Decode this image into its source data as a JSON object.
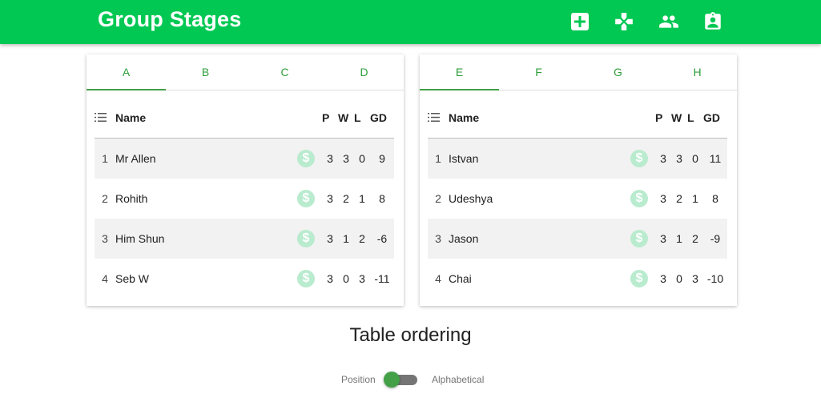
{
  "app": {
    "title": "Group Stages",
    "icons": [
      "add-box-icon",
      "gamepad-icon",
      "people-icon",
      "assignment-ind-icon"
    ],
    "accent": "#00c853"
  },
  "groups_left": {
    "tabs": [
      "A",
      "B",
      "C",
      "D"
    ],
    "active_tab": "A",
    "headers": {
      "name": "Name",
      "p": "P",
      "w": "W",
      "l": "L",
      "gd": "GD"
    },
    "rows": [
      {
        "pos": "1",
        "name": "Mr Allen",
        "p": "3",
        "w": "3",
        "l": "0",
        "gd": "9"
      },
      {
        "pos": "2",
        "name": "Rohith",
        "p": "3",
        "w": "2",
        "l": "1",
        "gd": "8"
      },
      {
        "pos": "3",
        "name": "Him Shun",
        "p": "3",
        "w": "1",
        "l": "2",
        "gd": "-6"
      },
      {
        "pos": "4",
        "name": "Seb W",
        "p": "3",
        "w": "0",
        "l": "3",
        "gd": "-11"
      }
    ]
  },
  "groups_right": {
    "tabs": [
      "E",
      "F",
      "G",
      "H"
    ],
    "active_tab": "E",
    "headers": {
      "name": "Name",
      "p": "P",
      "w": "W",
      "l": "L",
      "gd": "GD"
    },
    "rows": [
      {
        "pos": "1",
        "name": "Istvan",
        "p": "3",
        "w": "3",
        "l": "0",
        "gd": "11"
      },
      {
        "pos": "2",
        "name": "Udeshya",
        "p": "3",
        "w": "2",
        "l": "1",
        "gd": "8"
      },
      {
        "pos": "3",
        "name": "Jason",
        "p": "3",
        "w": "1",
        "l": "2",
        "gd": "-9"
      },
      {
        "pos": "4",
        "name": "Chai",
        "p": "3",
        "w": "0",
        "l": "3",
        "gd": "-10"
      }
    ]
  },
  "ordering": {
    "title": "Table ordering",
    "left_label": "Position",
    "right_label": "Alphabetical",
    "selected": "Position"
  }
}
